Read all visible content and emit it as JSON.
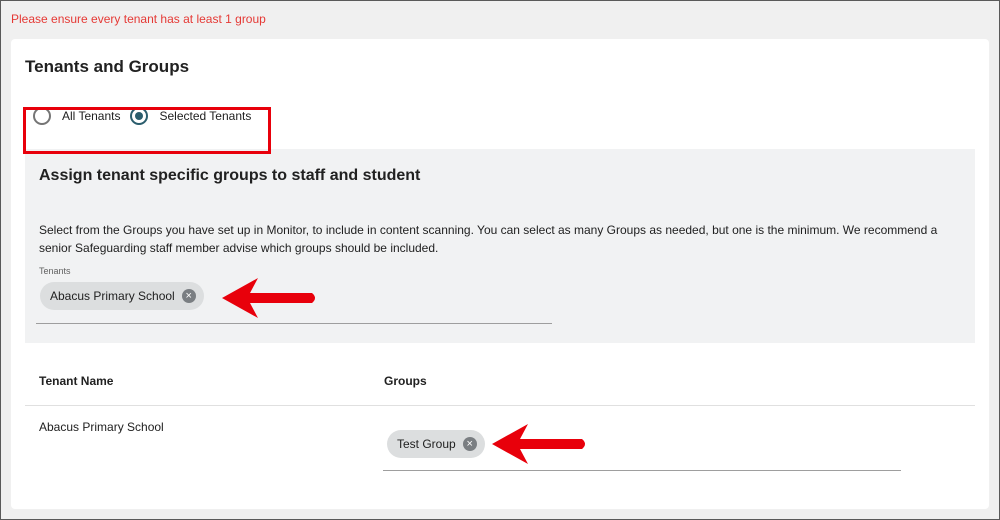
{
  "warning": "Please ensure every tenant has at least 1 group",
  "section_title": "Tenants and Groups",
  "scope": {
    "options": [
      {
        "label": "All Tenants",
        "checked": false
      },
      {
        "label": "Selected Tenants",
        "checked": true
      }
    ]
  },
  "assign": {
    "title": "Assign tenant specific groups to staff and student",
    "description": "Select from the Groups you have set up in Monitor, to include in content scanning. You can select as many Groups as needed, but one is the minimum. We recommend a senior Safeguarding staff member advise which groups should be included.",
    "tenants_label": "Tenants",
    "selected_tenants": [
      "Abacus Primary School"
    ]
  },
  "table": {
    "headers": {
      "tenant_name": "Tenant Name",
      "groups": "Groups"
    },
    "rows": [
      {
        "tenant_name": "Abacus Primary School",
        "groups": [
          "Test Group"
        ]
      }
    ]
  },
  "colors": {
    "accent": "#2b5d6d",
    "warning": "#e53935",
    "annotation": "#e8000b"
  },
  "icons": {
    "chip_remove": "close-circle-icon",
    "annotation_arrow": "arrow-left-icon"
  }
}
